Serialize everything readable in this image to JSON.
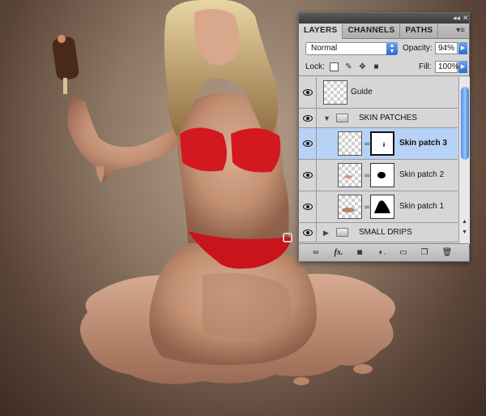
{
  "panel": {
    "tabs": [
      {
        "label": "LAYERS"
      },
      {
        "label": "CHANNELS"
      },
      {
        "label": "PATHS"
      }
    ],
    "blend_mode": "Normal",
    "opacity_label": "Opacity:",
    "opacity_value": "94%",
    "lock_label": "Lock:",
    "fill_label": "Fill:",
    "fill_value": "100%",
    "layers": [
      {
        "name": "Guide",
        "kind": "layer"
      },
      {
        "name": "SKIN PATCHES",
        "kind": "group",
        "expanded": true
      },
      {
        "name": "Skin patch 3",
        "kind": "masked",
        "selected": true
      },
      {
        "name": "Skin patch 2",
        "kind": "masked"
      },
      {
        "name": "Skin patch 1",
        "kind": "masked"
      },
      {
        "name": "SMALL DRIPS",
        "kind": "group",
        "expanded": false
      }
    ],
    "footer_icons": [
      "link-layers-icon",
      "fx-icon",
      "add-mask-icon",
      "adjustment-layer-icon",
      "new-group-icon",
      "new-layer-icon",
      "trash-icon"
    ],
    "accent_color": "#2a6bd2",
    "selection_color": "#b7d2f5"
  },
  "canvas": {
    "subject": "photo-illustration",
    "skin_color": "#c99b80",
    "swimsuit_color": "#d4181f",
    "popsicle_color": "#4a2a1a"
  }
}
